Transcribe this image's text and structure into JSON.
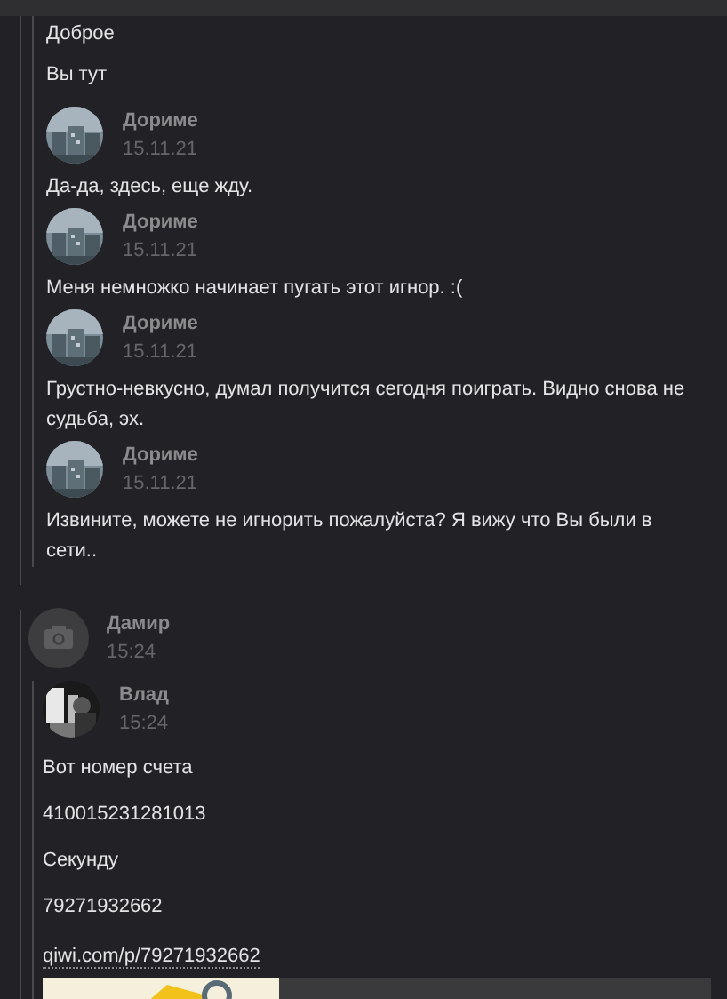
{
  "top_messages": [
    "Доброе",
    "Вы тут"
  ],
  "forwarded_1": [
    {
      "author": "Дориме",
      "date": "15.11.21",
      "text": "Да-да, здесь, еще жду."
    },
    {
      "author": "Дориме",
      "date": "15.11.21",
      "text": "Меня немножко начинает пугать этот игнор. :("
    },
    {
      "author": "Дориме",
      "date": "15.11.21",
      "text": "Грустно-невкусно, думал получится сегодня поиграть. Видно снова не судьба, эх."
    },
    {
      "author": "Дориме",
      "date": "15.11.21",
      "text": "Извините, можете не игнорить пожалуйста? Я вижу что Вы были в сети.."
    }
  ],
  "forwarded_2": {
    "author": "Дамир",
    "time": "15:24",
    "avatar": {
      "kind": "placeholder"
    },
    "nested": {
      "author": "Влад",
      "time": "15:24",
      "messages": [
        {
          "kind": "text",
          "text": "Вот номер счета"
        },
        {
          "kind": "text",
          "text": "410015231281013"
        },
        {
          "kind": "text",
          "text": "Секунду"
        },
        {
          "kind": "text",
          "text": "79271932662"
        },
        {
          "kind": "link",
          "text": "qiwi.com/p/79271932662"
        }
      ]
    }
  }
}
